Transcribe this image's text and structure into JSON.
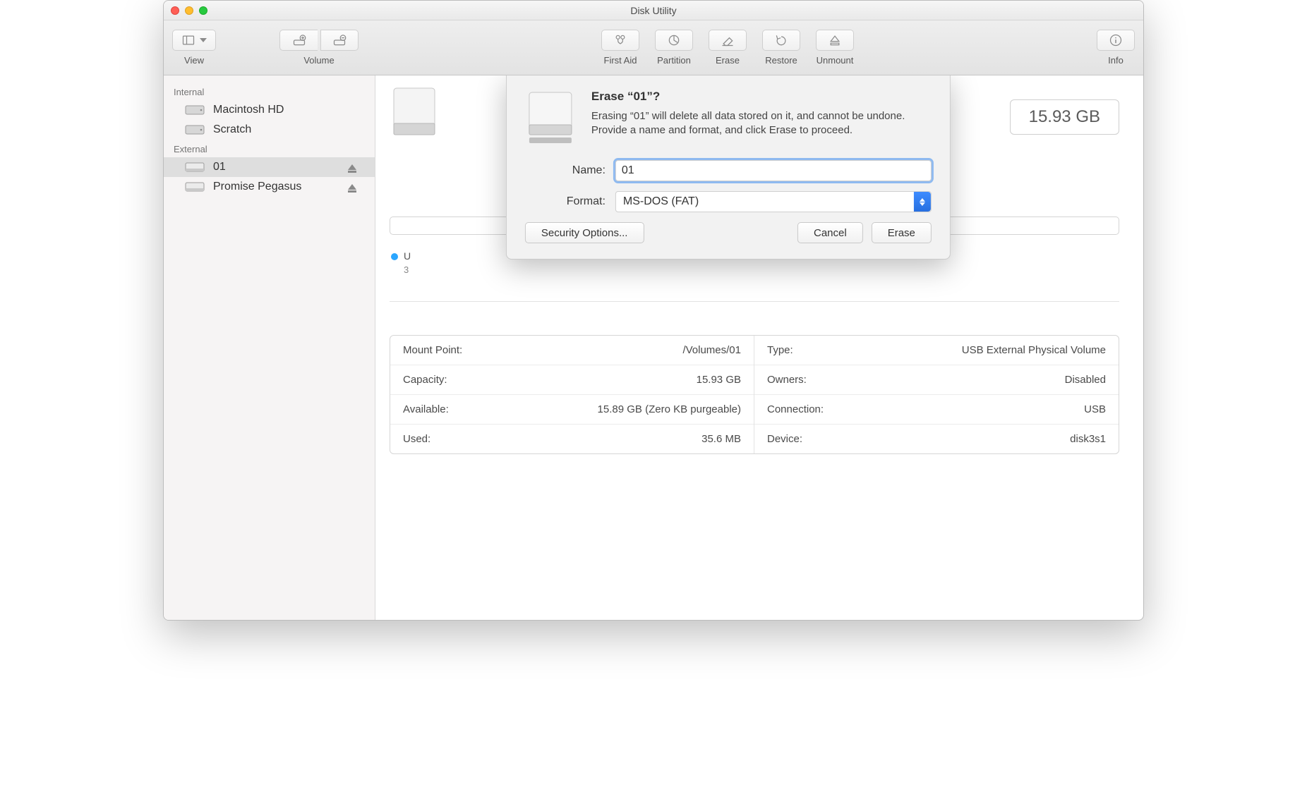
{
  "window": {
    "title": "Disk Utility"
  },
  "toolbar": {
    "view": "View",
    "volume": "Volume",
    "first_aid": "First Aid",
    "partition": "Partition",
    "erase": "Erase",
    "restore": "Restore",
    "unmount": "Unmount",
    "info": "Info"
  },
  "sidebar": {
    "internal_label": "Internal",
    "external_label": "External",
    "internal": [
      {
        "name": "Macintosh HD"
      },
      {
        "name": "Scratch"
      }
    ],
    "external": [
      {
        "name": "01"
      },
      {
        "name": "Promise Pegasus"
      }
    ]
  },
  "main": {
    "size_badge": "15.93 GB",
    "used_label_prefix": "U",
    "used_sub_prefix": "3"
  },
  "info": {
    "left": [
      {
        "key": "Mount Point:",
        "val": "/Volumes/01"
      },
      {
        "key": "Capacity:",
        "val": "15.93 GB"
      },
      {
        "key": "Available:",
        "val": "15.89 GB (Zero KB purgeable)"
      },
      {
        "key": "Used:",
        "val": "35.6 MB"
      }
    ],
    "right": [
      {
        "key": "Type:",
        "val": "USB External Physical Volume"
      },
      {
        "key": "Owners:",
        "val": "Disabled"
      },
      {
        "key": "Connection:",
        "val": "USB"
      },
      {
        "key": "Device:",
        "val": "disk3s1"
      }
    ]
  },
  "dialog": {
    "title": "Erase “01”?",
    "message": "Erasing “01” will delete all data stored on it, and cannot be undone. Provide a name and format, and click Erase to proceed.",
    "name_label": "Name:",
    "name_value": "01",
    "format_label": "Format:",
    "format_value": "MS-DOS (FAT)",
    "security_options": "Security Options...",
    "cancel": "Cancel",
    "erase": "Erase"
  },
  "colors": {
    "accent": "#2aa6ff"
  }
}
